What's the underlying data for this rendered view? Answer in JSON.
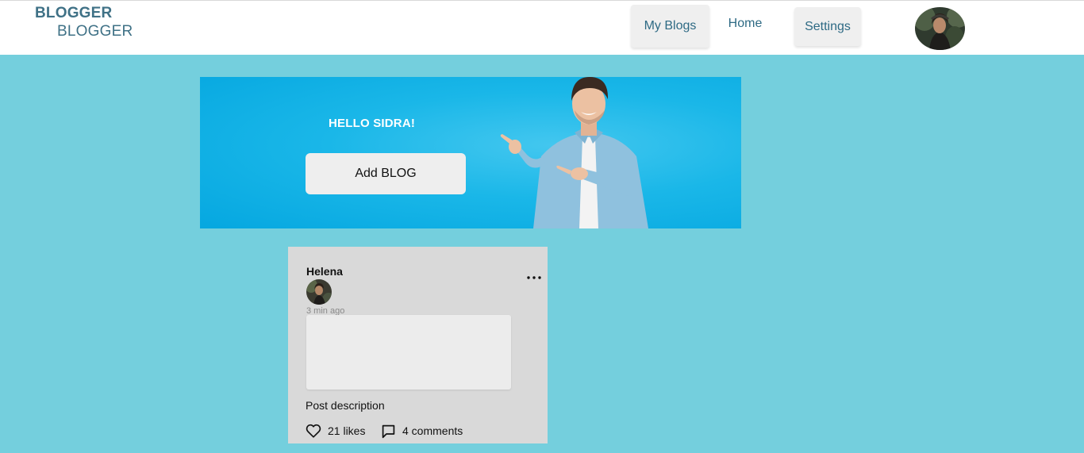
{
  "header": {
    "logo_line1": "BLOGGER",
    "logo_line2": "BLOGGER",
    "nav": {
      "my_blogs": "My Blogs",
      "home": "Home",
      "settings": "Settings"
    },
    "avatar_icon": "user-avatar"
  },
  "banner": {
    "greeting": "HELLO SIDRA!",
    "add_blog_label": "Add BLOG"
  },
  "post": {
    "author": "Helena",
    "time": "3 min ago",
    "description": "Post description",
    "likes": "21 likes",
    "comments": "4 comments",
    "icons": {
      "menu": "more-horizontal-icon",
      "like": "heart-icon",
      "comment": "comment-icon"
    }
  },
  "colors": {
    "page_bg": "#74cfdd",
    "brand": "#3f7186",
    "banner": "#05a7e0",
    "card": "#d9d9d9"
  }
}
